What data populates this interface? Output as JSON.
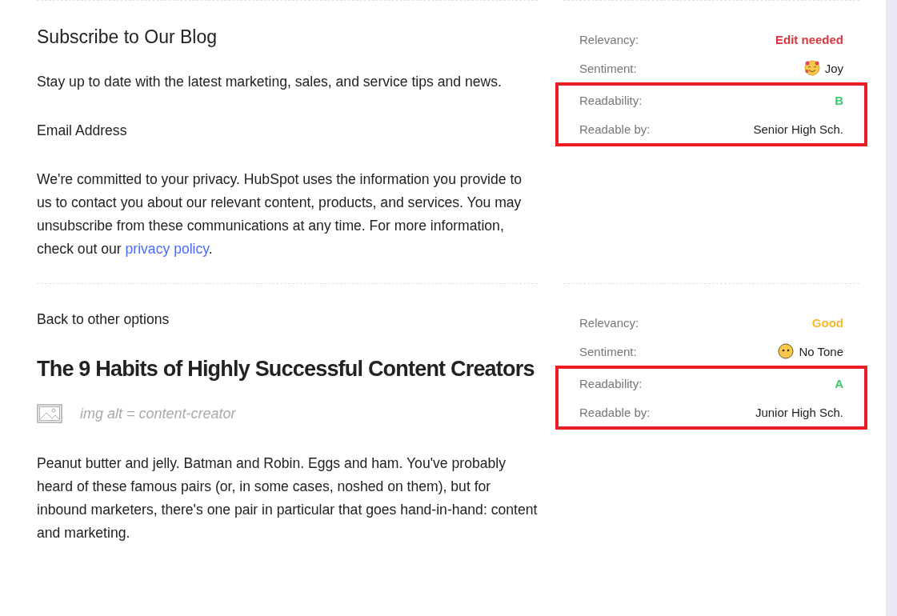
{
  "sections": [
    {
      "content": [
        {
          "kind": "heading",
          "text": "Subscribe to Our Blog"
        },
        {
          "kind": "paragraph",
          "text": "Stay up to date with the latest marketing, sales, and service tips and news."
        },
        {
          "kind": "paragraph",
          "text": "Email Address"
        },
        {
          "kind": "paragraph",
          "text": "We're committed to your privacy. HubSpot uses the information you provide to us to contact you about our relevant content, products, and services. You may unsubscribe from these communications at any time. For more information, check out our",
          "link": "privacy policy",
          "after": "."
        }
      ],
      "metrics": [
        {
          "kind": "text",
          "label": "Relevancy:",
          "value": "Edit needed",
          "color": "#d9363e"
        },
        {
          "kind": "joy",
          "label": "Sentiment:",
          "value": "Joy"
        }
      ],
      "callout": {
        "highlighted": true,
        "metrics": [
          {
            "kind": "text",
            "label": "Readability:",
            "value": "B",
            "color": "#3ec96e"
          },
          {
            "kind": "plain",
            "label": "Readable by:",
            "value": "Senior High Sch."
          }
        ]
      }
    },
    {
      "content": [
        {
          "kind": "paragraph",
          "text": "Back to other options"
        },
        {
          "kind": "title",
          "text": "The 9 Habits of Highly Successful Content Creators"
        },
        {
          "kind": "image_alt",
          "text": "img alt = content-creator"
        },
        {
          "kind": "paragraph",
          "text": "Peanut butter and jelly. Batman and Robin. Eggs and ham. You've probably heard of these famous pairs (or, in some cases, noshed on them), but for inbound marketers, there's one pair in particular that goes hand-in-hand: content and marketing."
        }
      ],
      "metrics": [
        {
          "kind": "text",
          "label": "Relevancy:",
          "value": "Good",
          "color": "#f7b731"
        },
        {
          "kind": "neutral",
          "label": "Sentiment:",
          "value": "No Tone"
        }
      ],
      "callout": {
        "highlighted": true,
        "metrics": [
          {
            "kind": "text",
            "label": "Readability:",
            "value": "A",
            "color": "#3ec96e"
          },
          {
            "kind": "plain",
            "label": "Readable by:",
            "value": "Junior High Sch."
          }
        ]
      }
    }
  ]
}
